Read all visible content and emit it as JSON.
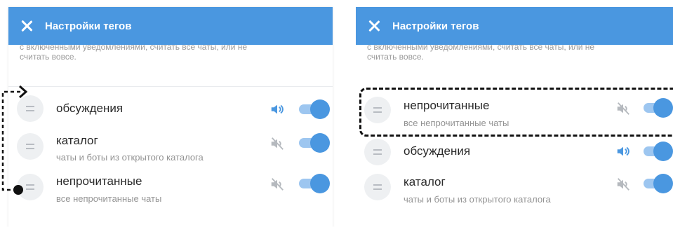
{
  "colors": {
    "header_bg": "#4a97e0",
    "toggle_track": "#9dc6f0",
    "toggle_knob": "#4a97e0",
    "sound_on": "#4a97e0",
    "sound_off": "#b5b9be",
    "desc_text": "#9a9a9a"
  },
  "left_panel": {
    "title": "Настройки тегов",
    "description_line1": "с включенными уведомлениями, считать все чаты, или не",
    "description_line2": "считать вовсе.",
    "items": [
      {
        "title": "обсуждения",
        "subtitle": "",
        "sound_icon": "speaker-on-icon",
        "toggle_on": true
      },
      {
        "title": "каталог",
        "subtitle": "чаты и боты из открытого каталога",
        "sound_icon": "speaker-muted-icon",
        "toggle_on": true
      },
      {
        "title": "непрочитанные",
        "subtitle": "все непрочитанные чаты",
        "sound_icon": "speaker-muted-icon",
        "toggle_on": true
      }
    ]
  },
  "right_panel": {
    "title": "Настройки тегов",
    "description_line1": "с включенными уведомлениями, считать все чаты, или не",
    "description_line2": "считать вовсе.",
    "items": [
      {
        "title": "непрочитанные",
        "subtitle": "все непрочитанные чаты",
        "sound_icon": "speaker-muted-icon",
        "toggle_on": true
      },
      {
        "title": "обсуждения",
        "subtitle": "",
        "sound_icon": "speaker-on-icon",
        "toggle_on": true
      },
      {
        "title": "каталог",
        "subtitle": "чаты и боты из открытого каталога",
        "sound_icon": "speaker-muted-icon",
        "toggle_on": true
      }
    ]
  }
}
